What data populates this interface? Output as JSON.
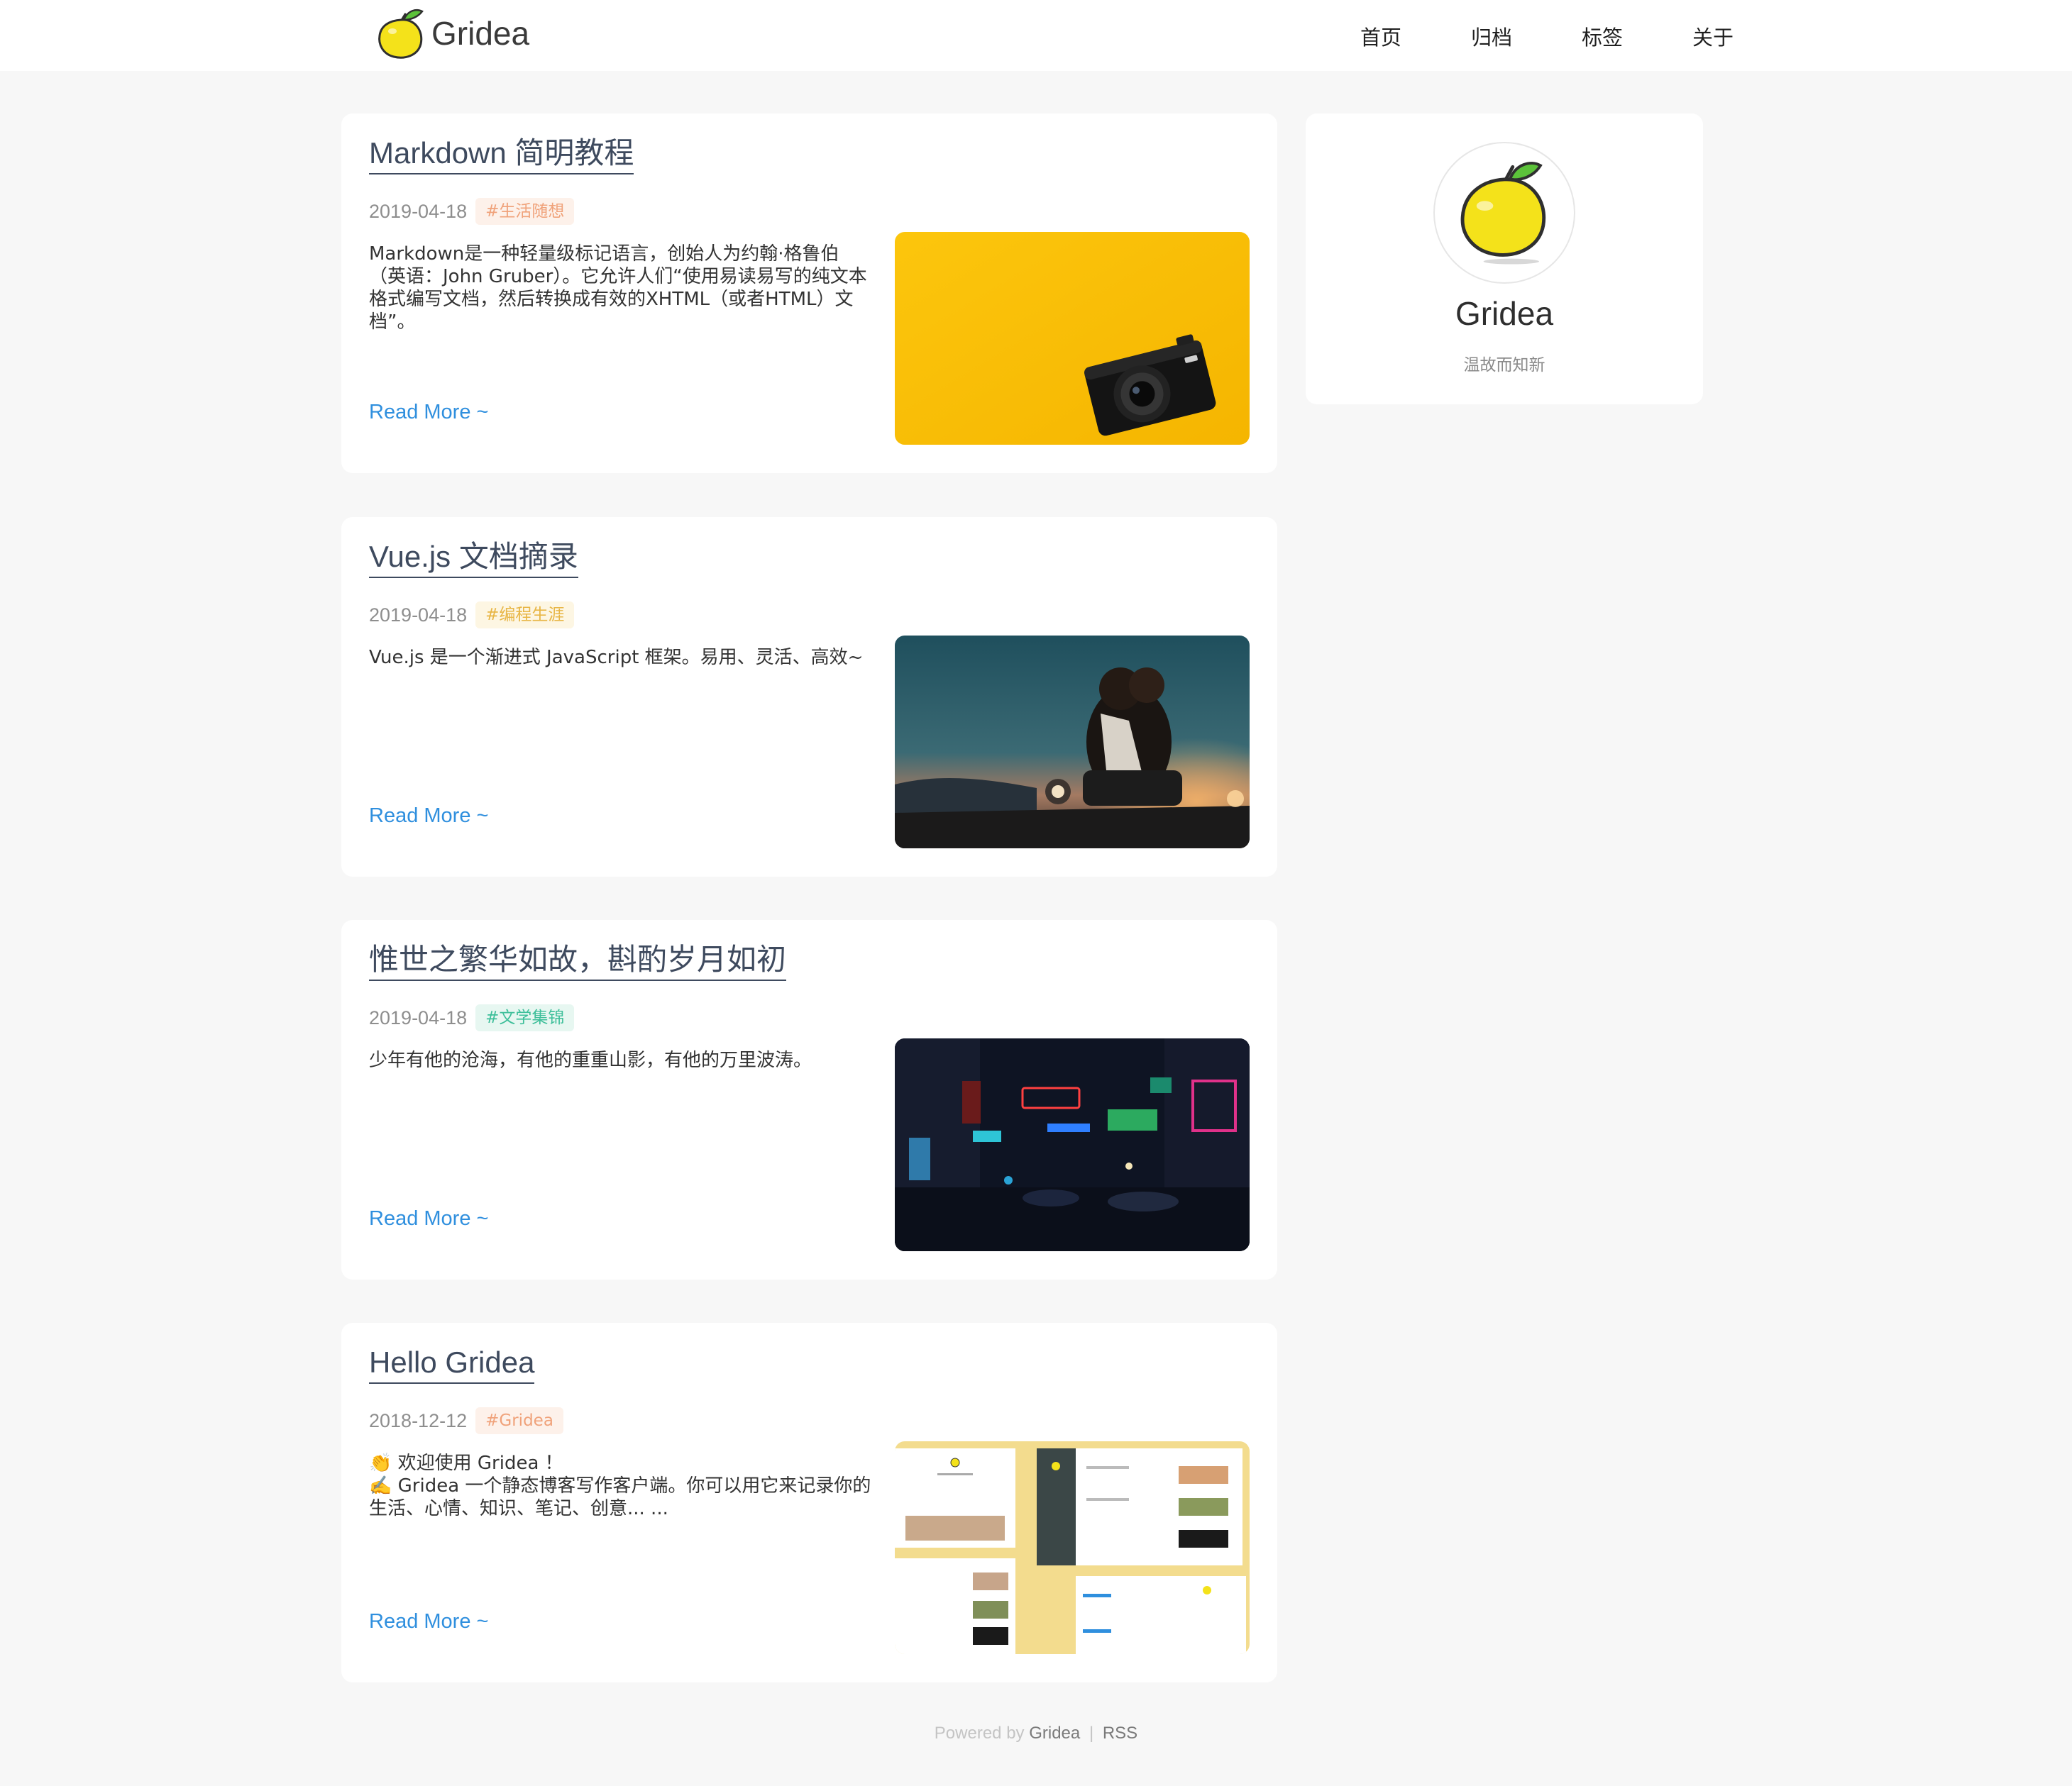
{
  "header": {
    "site_name": "Gridea",
    "logo_icon": "lemon-icon",
    "nav": [
      {
        "label": "首页"
      },
      {
        "label": "归档"
      },
      {
        "label": "标签"
      },
      {
        "label": "关于"
      }
    ]
  },
  "posts": [
    {
      "title": "Markdown 简明教程",
      "date": "2019-04-18",
      "tag": "#生活随想",
      "tag_color": "#f0a27a",
      "tag_bg": "#fdf1ea",
      "abstract": [
        "Markdown是一种轻量级标记语言，创始人为约翰·格鲁伯（英语：John Gruber）。它允许人们“使用易读易写的纯文本格式编写文档，然后转换成有效的XHTML（或者HTML）文档”。"
      ],
      "read_more": "Read More ~",
      "image": "camera-on-yellow-image"
    },
    {
      "title": "Vue.js 文档摘录",
      "date": "2019-04-18",
      "tag": "#编程生涯",
      "tag_color": "#e8b646",
      "tag_bg": "#fdf6e3",
      "abstract": [
        "Vue.js 是一个渐进式 JavaScript 框架。易用、灵活、高效~"
      ],
      "read_more": "Read More ~",
      "image": "motorcycle-dusk-image"
    },
    {
      "title": "惟世之繁华如故，斟酌岁月如初",
      "date": "2019-04-18",
      "tag": "#文学集锦",
      "tag_color": "#3ebf9a",
      "tag_bg": "#e7f7f1",
      "abstract": [
        "少年有他的沧海，有他的重重山影，有他的万里波涛。"
      ],
      "read_more": "Read More ~",
      "image": "night-street-image"
    },
    {
      "title": "Hello Gridea",
      "date": "2018-12-12",
      "tag": "#Gridea",
      "tag_color": "#f0a27a",
      "tag_bg": "#fdf1ea",
      "abstract": [
        "👏  欢迎使用 Gridea ！",
        "✍️  Gridea 一个静态博客写作客户端。你可以用它来记录你的生活、心情、知识、笔记、创意... ..."
      ],
      "read_more": "Read More ~",
      "image": "gridea-screenshots-image"
    }
  ],
  "sidebar": {
    "avatar_icon": "lemon-icon",
    "name": "Gridea",
    "description": "温故而知新"
  },
  "footer": {
    "powered_by": "Powered by",
    "gridea_link": "Gridea",
    "separator": "|",
    "rss_link": "RSS"
  },
  "colors": {
    "link": "#2f8fde",
    "title": "#3e4a5e",
    "background": "#f7f7f7"
  }
}
